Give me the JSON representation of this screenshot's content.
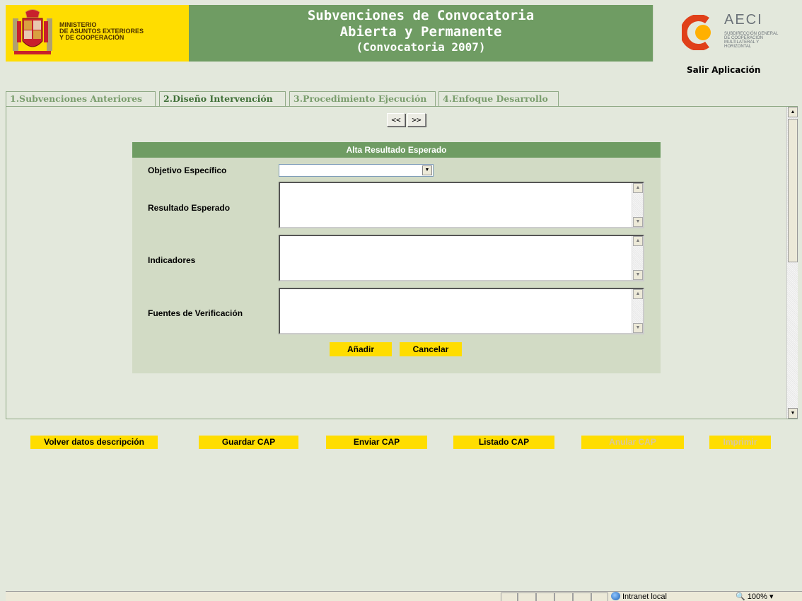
{
  "header": {
    "ministry_lines": [
      "MINISTERIO",
      "DE ASUNTOS EXTERIORES",
      "Y DE COOPERACIÓN"
    ],
    "title_line1": "Subvenciones de Convocatoria",
    "title_line2": "Abierta y Permanente",
    "title_line3": "(Convocatoria 2007)",
    "agency_name": "AECI",
    "agency_sub": [
      "SUBDIRECCIÓN GENERAL",
      "DE COOPERACIÓN",
      "MULTILATERAL Y",
      "HORIZONTAL"
    ],
    "exit_link": "Salir Aplicación"
  },
  "tabs": [
    {
      "label": "1.Subvenciones Anteriores",
      "active": false
    },
    {
      "label": "2.Diseño Intervención",
      "active": true
    },
    {
      "label": "3.Procedimiento Ejecución",
      "active": false
    },
    {
      "label": "4.Enfoque Desarrollo",
      "active": false
    }
  ],
  "nav": {
    "prev_label": "<<",
    "next_label": ">>"
  },
  "form": {
    "title": "Alta Resultado Esperado",
    "objetivo_label": "Objetivo Específico",
    "objetivo_value": "",
    "resultado_label": "Resultado Esperado",
    "resultado_value": "",
    "indicadores_label": "Indicadores",
    "indicadores_value": "",
    "fuentes_label": "Fuentes de Verificación",
    "fuentes_value": "",
    "add_label": "Añadir",
    "cancel_label": "Cancelar"
  },
  "actions": [
    {
      "label": "Volver datos descripción",
      "enabled": true
    },
    {
      "label": "Guardar CAP",
      "enabled": true
    },
    {
      "label": "Enviar CAP",
      "enabled": true
    },
    {
      "label": "Listado CAP",
      "enabled": true
    },
    {
      "label": "Anular CAP",
      "enabled": false
    },
    {
      "label": "Imprimir",
      "enabled": false
    }
  ],
  "statusbar": {
    "zone": "Intranet local",
    "zoom": "100%"
  },
  "colors": {
    "brand_yellow": "#ffdd00",
    "brand_green": "#6f9c63",
    "page_bg": "#e3e8dc",
    "panel_bg": "#d2dbc5"
  }
}
